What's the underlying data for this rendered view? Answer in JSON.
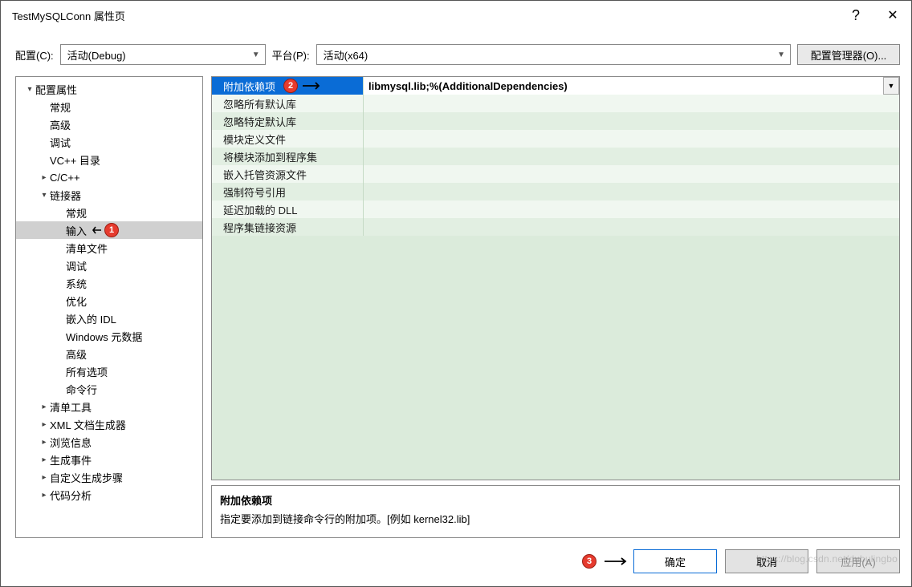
{
  "titlebar": {
    "title": "TestMySQLConn 属性页",
    "help": "?",
    "close": "✕"
  },
  "toprow": {
    "config_label": "配置(C):",
    "config_value": "活动(Debug)",
    "platform_label": "平台(P):",
    "platform_value": "活动(x64)",
    "cfgmgr": "配置管理器(O)..."
  },
  "tree": {
    "root": "配置属性",
    "items_lvl1": [
      "常规",
      "高级",
      "调试",
      "VC++ 目录"
    ],
    "cpp": "C/C++",
    "linker": "链接器",
    "linker_children": [
      "常规",
      "输入",
      "清单文件",
      "调试",
      "系统",
      "优化",
      "嵌入的 IDL",
      "Windows 元数据",
      "高级",
      "所有选项",
      "命令行"
    ],
    "rest": [
      "清单工具",
      "XML 文档生成器",
      "浏览信息",
      "生成事件",
      "自定义生成步骤",
      "代码分析"
    ]
  },
  "grid": {
    "rows": [
      {
        "label": "附加依赖项",
        "value": "libmysql.lib;%(AdditionalDependencies)",
        "selected": true
      },
      {
        "label": "忽略所有默认库",
        "value": ""
      },
      {
        "label": "忽略特定默认库",
        "value": ""
      },
      {
        "label": "模块定义文件",
        "value": ""
      },
      {
        "label": "将模块添加到程序集",
        "value": ""
      },
      {
        "label": "嵌入托管资源文件",
        "value": ""
      },
      {
        "label": "强制符号引用",
        "value": ""
      },
      {
        "label": "延迟加载的 DLL",
        "value": ""
      },
      {
        "label": "程序集链接资源",
        "value": ""
      }
    ]
  },
  "desc": {
    "title": "附加依赖项",
    "body": "指定要添加到链接命令行的附加项。[例如 kernel32.lib]"
  },
  "buttons": {
    "ok": "确定",
    "cancel": "取消",
    "apply": "应用(A)"
  },
  "callouts": {
    "c1": "1",
    "c2": "2",
    "c3": "3"
  },
  "watermark": "https://blog.csdn.net/dubulingbo"
}
